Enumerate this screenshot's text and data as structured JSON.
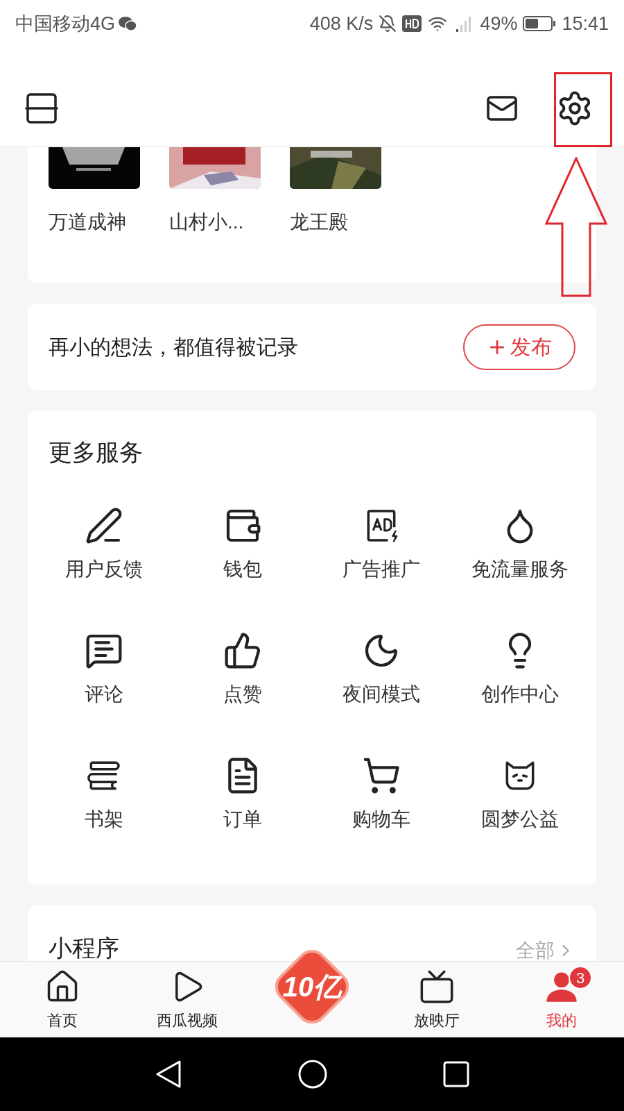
{
  "status_bar": {
    "carrier": "中国移动4G",
    "network_speed": "408 K/s",
    "battery": "49%",
    "time": "15:41"
  },
  "recent_books": [
    {
      "title": "万道成神"
    },
    {
      "title": "山村小..."
    },
    {
      "title": "龙王殿"
    }
  ],
  "publish": {
    "prompt": "再小的想法，都值得被记录",
    "button": "发布"
  },
  "services": {
    "title": "更多服务",
    "items": [
      {
        "label": "用户反馈"
      },
      {
        "label": "钱包"
      },
      {
        "label": "广告推广"
      },
      {
        "label": "免流量服务"
      },
      {
        "label": "评论"
      },
      {
        "label": "点赞"
      },
      {
        "label": "夜间模式"
      },
      {
        "label": "创作中心"
      },
      {
        "label": "书架"
      },
      {
        "label": "订单"
      },
      {
        "label": "购物车"
      },
      {
        "label": "圆梦公益"
      }
    ]
  },
  "mini_programs": {
    "title": "小程序",
    "link": "全部"
  },
  "bottom_nav": [
    {
      "kind": "tab",
      "label": "首页",
      "selected": false
    },
    {
      "kind": "tab",
      "label": "西瓜视频",
      "selected": false
    },
    {
      "kind": "promo",
      "label": "10亿"
    },
    {
      "kind": "tab",
      "label": "放映厅",
      "selected": false
    },
    {
      "kind": "tab",
      "label": "我的",
      "selected": true,
      "badge": "3"
    }
  ]
}
